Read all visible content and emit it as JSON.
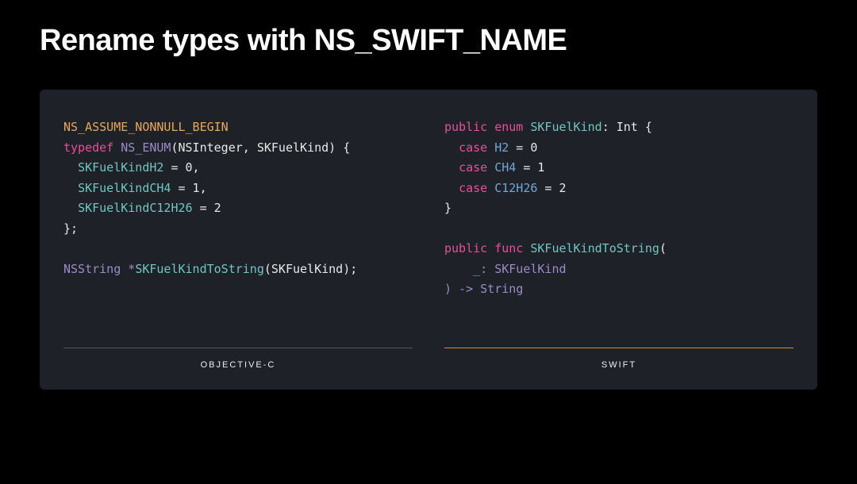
{
  "title": "Rename types with NS_SWIFT_NAME",
  "left": {
    "lang": "OBJECTIVE-C",
    "macro": "NS_ASSUME_NONNULL_BEGIN",
    "typedef": "typedef",
    "nsenum": "NS_ENUM",
    "enum_args": "(NSInteger, SKFuelKind) {",
    "case1": "SKFuelKindH2",
    "case1_val": " = 0,",
    "case2": "SKFuelKindCH4",
    "case2_val": " = 1,",
    "case3": "SKFuelKindC12H26",
    "case3_val": " = 2",
    "close": "};",
    "ret_type": "NSString *",
    "fn_name": "SKFuelKindToString",
    "fn_args": "(SKFuelKind);"
  },
  "right": {
    "lang": "SWIFT",
    "public": "public",
    "enum": "enum",
    "type_name": "SKFuelKind",
    "type_sig": ": Int {",
    "case_kw": "case",
    "c1": "H2",
    "c1v": " = 0",
    "c2": "CH4",
    "c2v": " = 1",
    "c3": "C12H26",
    "c3v": " = 2",
    "close": "}",
    "func": "func",
    "fn_name": "SKFuelKindToString",
    "fn_open": "(",
    "arg_label": "_",
    "arg_type": ": SKFuelKind",
    "ret": ") -> String"
  }
}
